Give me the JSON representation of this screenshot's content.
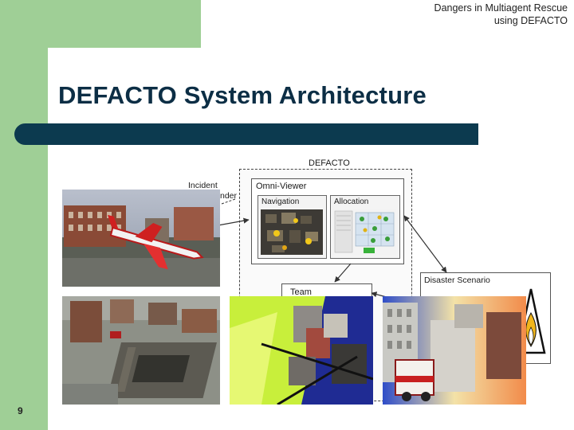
{
  "header": {
    "line1": "Dangers in Multiagent Rescue",
    "line2": "using DEFACTO"
  },
  "title": "DEFACTO System Architecture",
  "slide_number": "9",
  "diagram": {
    "system_label": "DEFACTO",
    "incident_label": "Incident",
    "commander_label_partial": "nder",
    "omni_viewer_label": "Omni-Viewer",
    "navigation_label": "Navigation",
    "allocation_label": "Allocation",
    "team_label": "Team",
    "disaster_label": "Disaster Scenario"
  },
  "colors": {
    "frame_green": "#9fcf96",
    "title_navy": "#0c2e45",
    "bar_navy": "#0c3a4f"
  }
}
